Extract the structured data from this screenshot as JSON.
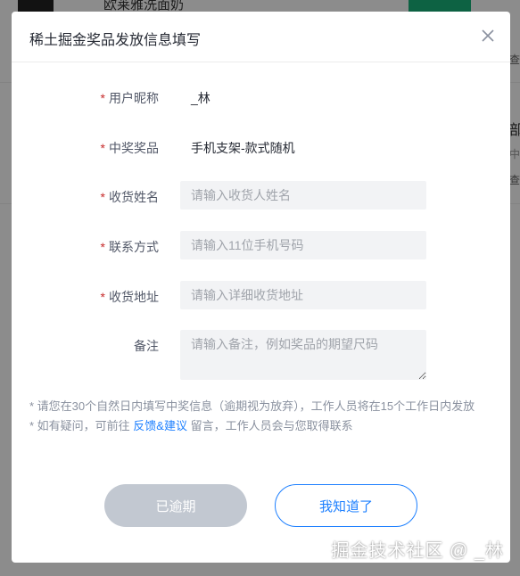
{
  "background": {
    "product_title": "欧莱雅洗面奶",
    "side_text_1": "部",
    "side_text_2": "中",
    "side_text_3": "查",
    "side_text_4": "查"
  },
  "modal": {
    "title": "稀土掘金奖品发放信息填写",
    "close_icon": "close-icon",
    "fields": [
      {
        "label": "用户昵称",
        "required": "*",
        "value": "_林"
      },
      {
        "label": "中奖奖品",
        "required": "*",
        "value": "手机支架-款式随机"
      },
      {
        "label": "收货姓名",
        "required": "*",
        "placeholder": "请输入收货人姓名"
      },
      {
        "label": "联系方式",
        "required": "*",
        "placeholder": "请输入11位手机号码"
      },
      {
        "label": "收货地址",
        "required": "*",
        "placeholder": "请输入详细收货地址"
      },
      {
        "label": "备注",
        "required": "",
        "placeholder": "请输入备注，例如奖品的期望尺码"
      }
    ],
    "notes": {
      "line1": "* 请您在30个自然日内填写中奖信息（逾期视为放弃），工作人员将在15个工作日内发放",
      "line2_prefix": "* 如有疑问，可前往 ",
      "line2_link": "反馈&建议",
      "line2_suffix": " 留言，工作人员会与您取得联系"
    },
    "buttons": {
      "expired_label": "已逾期",
      "ok_label": "我知道了"
    }
  },
  "watermark": "掘金技术社区 @ _林",
  "colors": {
    "accent": "#1e80ff",
    "required": "#c62a2a",
    "disabled_button": "#c2c8d1"
  }
}
